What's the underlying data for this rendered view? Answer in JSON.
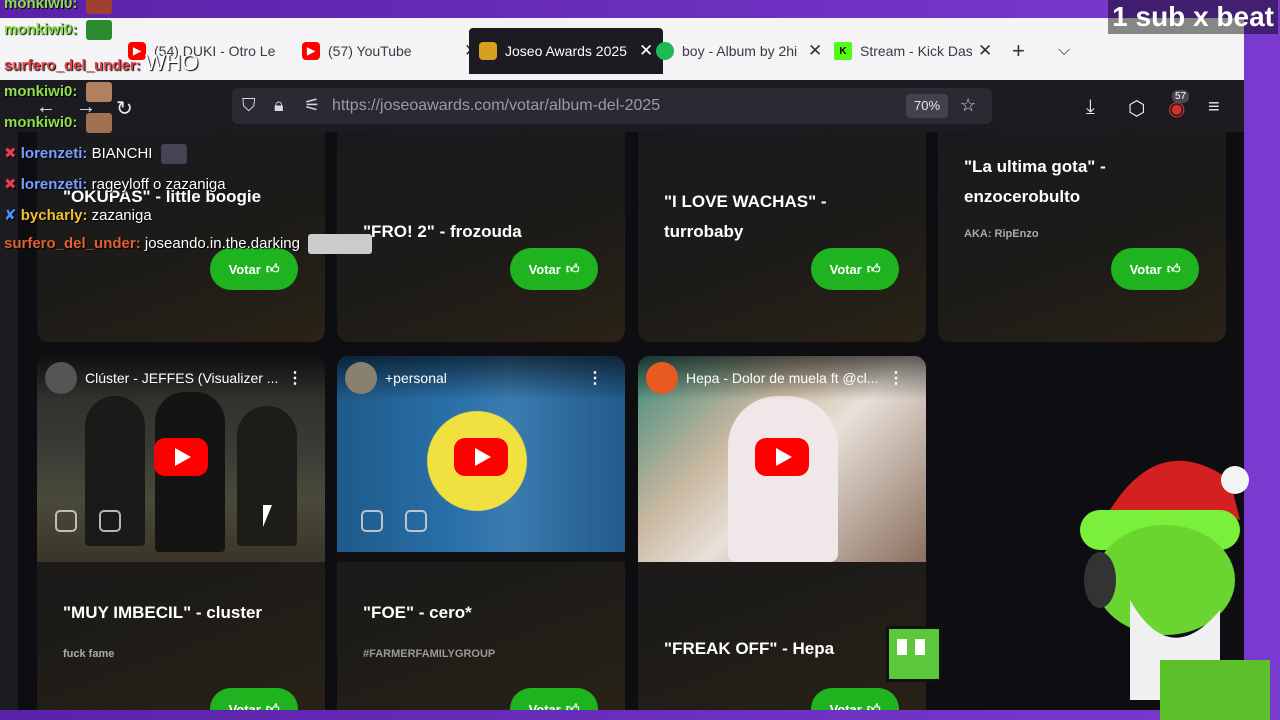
{
  "overlay": {
    "sub_banner": "1 sub x beat",
    "chat": [
      {
        "user": "monkiwi0:",
        "message": ""
      },
      {
        "user": "monkiwi0:",
        "message": ""
      },
      {
        "user": "surfero_del_under:",
        "message": "WHO"
      },
      {
        "user": "monkiwi0:",
        "message": ""
      },
      {
        "user": "monkiwi0:",
        "message": ""
      },
      {
        "user": "lorenzeti:",
        "message": "BIANCHI"
      },
      {
        "user": "lorenzeti:",
        "message": "rageyloff o zazaniga"
      },
      {
        "user": "bycharly:",
        "message": "zazaniga"
      },
      {
        "user": "surfero_del_under:",
        "message": "joseando.in.the.darking"
      }
    ]
  },
  "browser": {
    "tabs": [
      {
        "label": "(54) DUKI - Otro Le",
        "icon": "youtube-icon"
      },
      {
        "label": "(57) YouTube",
        "icon": "youtube-icon"
      },
      {
        "label": "Joseo Awards 2025",
        "icon": "trophy-icon"
      },
      {
        "label": "boy - Album by 2hi",
        "icon": "spotify-icon"
      },
      {
        "label": "Stream - Kick Dash",
        "icon": "kick-icon"
      }
    ],
    "url": "https://joseoawards.com/votar/album-del-2025",
    "zoom": "70%",
    "extension_badge": "57"
  },
  "page": {
    "vote_label": "Votar",
    "top_cards": [
      {
        "title": "\"OKUPAS\" - little boogie",
        "sub": ""
      },
      {
        "title": "\"FRO! 2\" - frozouda",
        "sub": ""
      },
      {
        "title": "\"I LOVE WACHAS\" - turrobaby",
        "sub": ""
      },
      {
        "title": "\"La ultima gota\" - enzocerobulto",
        "sub": "AKA: RipEnzo"
      }
    ],
    "bottom_cards": [
      {
        "video_title": "Clúster - JEFFES (Visualizer ...",
        "title": "\"MUY IMBECIL\" - cluster",
        "sub": "fuck fame"
      },
      {
        "video_title": "+personal",
        "title": "\"FOE\" - cero*",
        "sub": "#FARMERFAMILYGROUP"
      },
      {
        "video_title": "Hepa - Dolor de muela ft @cl...",
        "title": "\"FREAK OFF\" - Hepa",
        "sub": ""
      }
    ]
  }
}
